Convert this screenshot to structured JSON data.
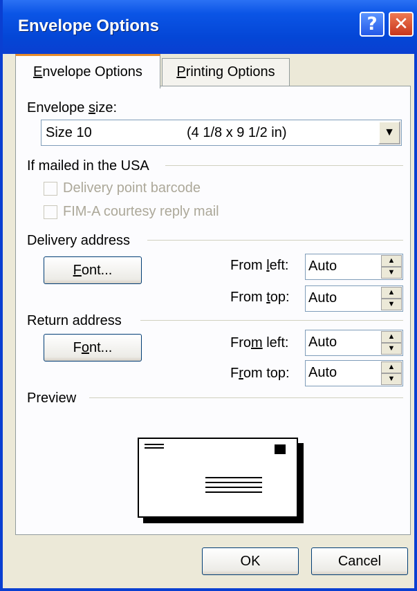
{
  "window": {
    "title": "Envelope Options",
    "help_glyph": "?",
    "close_glyph": "✕"
  },
  "tabs": [
    {
      "label_pre": "",
      "label_key": "E",
      "label_post": "nvelope Options",
      "active": true
    },
    {
      "label_pre": "",
      "label_key": "P",
      "label_post": "rinting Options",
      "active": false
    }
  ],
  "envelope_size": {
    "label_pre": "Envelope ",
    "label_key": "s",
    "label_post": "ize:",
    "selected_name": "Size 10",
    "selected_dims": "(4 1/8 x 9 1/2 in)",
    "dropdown_glyph": "▼"
  },
  "usa_group": {
    "title": "If mailed in the USA",
    "barcode_label": "Delivery point barcode",
    "fim_label": "FIM-A courtesy reply mail"
  },
  "delivery": {
    "title": "Delivery address",
    "font_btn_pre": "",
    "font_btn_key": "F",
    "font_btn_post": "ont...",
    "left_label_pre": "From ",
    "left_label_key": "l",
    "left_label_post": "eft:",
    "left_value": "Auto",
    "top_label_pre": "From ",
    "top_label_key": "t",
    "top_label_post": "op:",
    "top_value": "Auto"
  },
  "return": {
    "title": "Return address",
    "font_btn_pre": "F",
    "font_btn_key": "o",
    "font_btn_post": "nt...",
    "left_label_pre": "Fro",
    "left_label_key": "m",
    "left_label_post": " left:",
    "left_value": "Auto",
    "top_label_pre": "F",
    "top_label_key": "r",
    "top_label_post": "om top:",
    "top_value": "Auto"
  },
  "preview": {
    "title": "Preview"
  },
  "buttons": {
    "ok": "OK",
    "cancel": "Cancel"
  },
  "colors": {
    "titlebar": "#0a3fd1",
    "dialog_bg": "#ece9d8",
    "active_tab_accent": "#e68b2c"
  }
}
